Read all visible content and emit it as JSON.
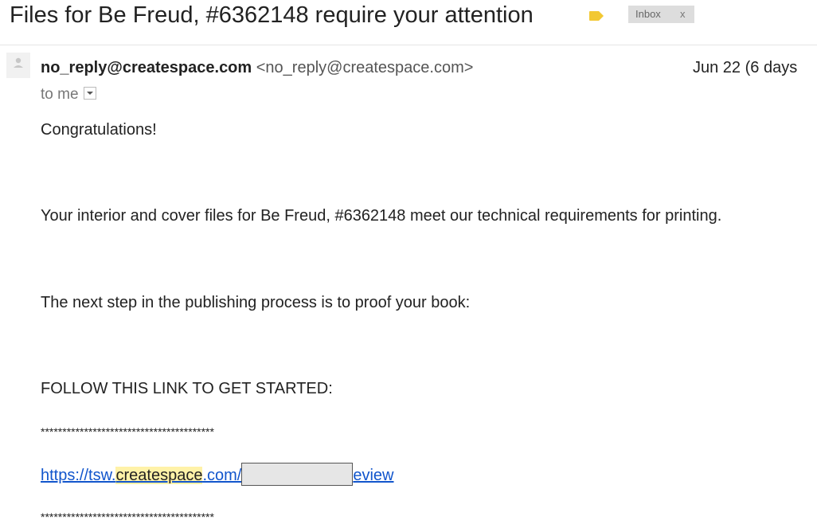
{
  "header": {
    "subject": "Files for Be Freud, #6362148 require your attention",
    "label_color": "#f2c832",
    "inbox_chip": {
      "label": "Inbox",
      "close": "x"
    }
  },
  "message": {
    "sender_name": "no_reply@createspace.com",
    "sender_email": "<no_reply@createspace.com>",
    "date": "Jun 22 (6 days",
    "to": "to me",
    "body": {
      "greeting": "Congratulations!",
      "line1": "Your interior and cover files for Be Freud, #6362148 meet our technical requirements for printing.",
      "line2": "The next step in the publishing process is to proof your book:",
      "cta": "FOLLOW THIS LINK TO GET STARTED:",
      "stars": "****************************************",
      "link": {
        "prefix": "https://tsw.",
        "highlight": "createspace",
        "after": ".com/",
        "suffix": "eview"
      }
    }
  }
}
